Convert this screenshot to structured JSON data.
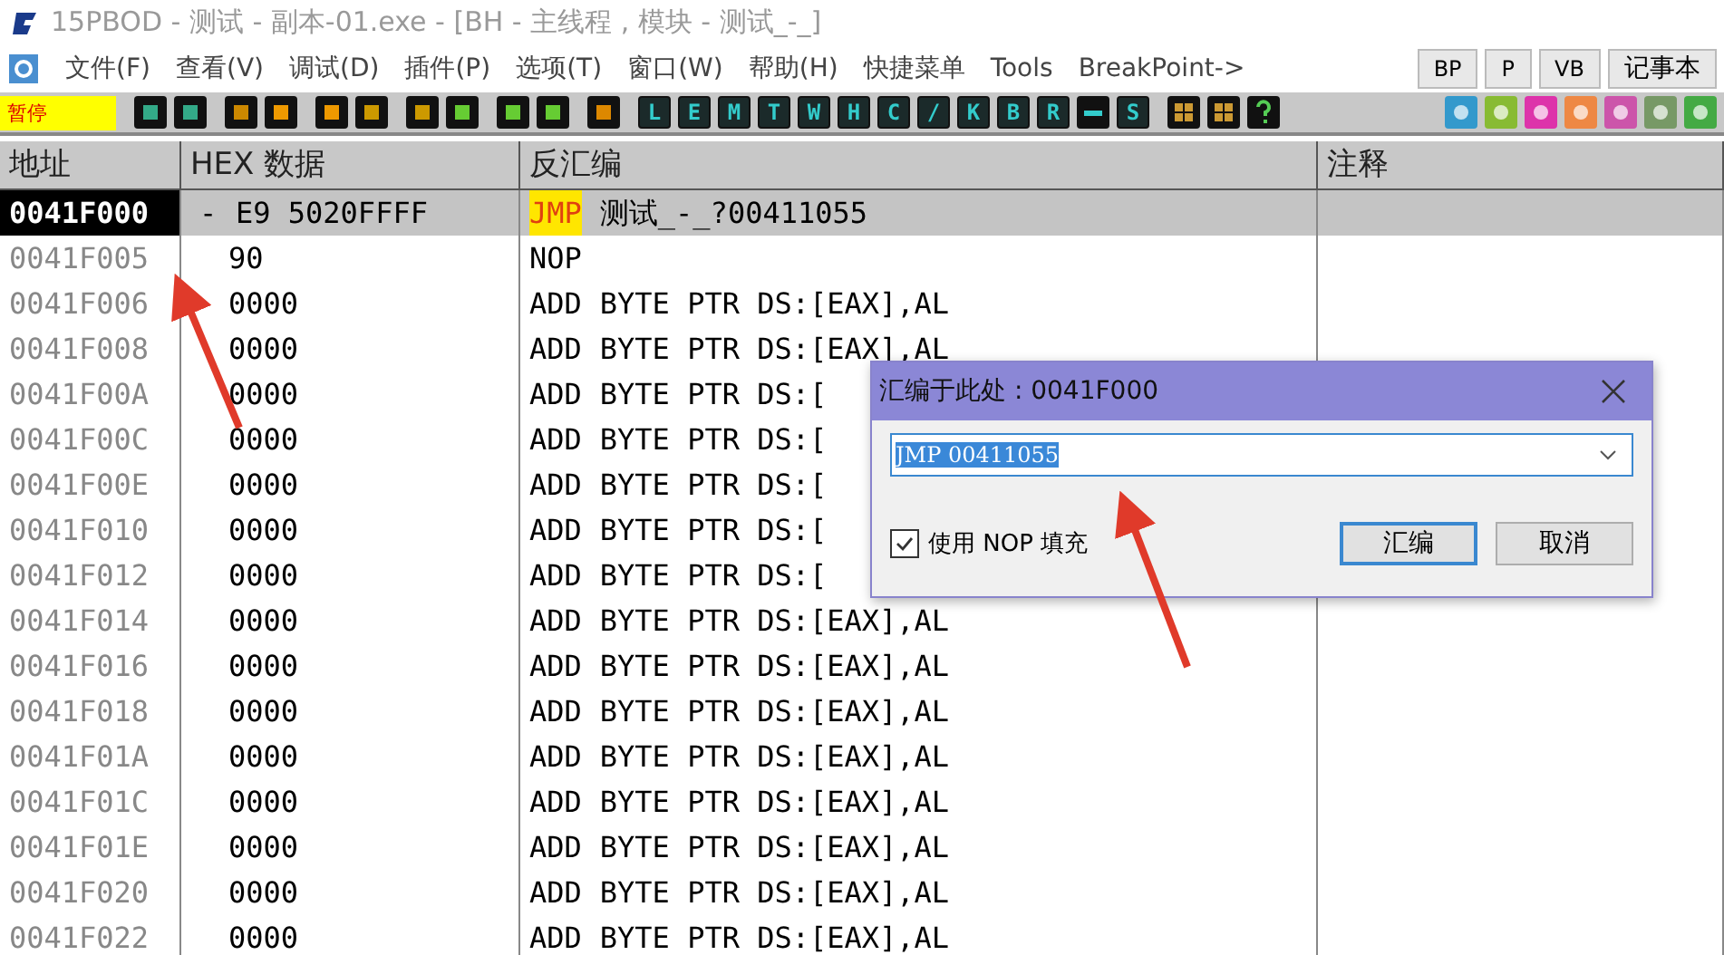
{
  "window": {
    "title": "15PBOD  - 测试 - 副本-01.exe - [BH - 主线程 , 模块 - 测试_-_]"
  },
  "menu": [
    "文件(F)",
    "查看(V)",
    "调试(D)",
    "插件(P)",
    "选项(T)",
    "窗口(W)",
    "帮助(H)",
    "快捷菜单",
    "Tools",
    "BreakPoint->"
  ],
  "menu_buttons": [
    "BP",
    "P",
    "VB",
    "记事本"
  ],
  "status": "暂停",
  "toolbar_letters": [
    {
      "kind": "letter",
      "label": "L"
    },
    {
      "kind": "letter",
      "label": "E"
    },
    {
      "kind": "letter",
      "label": "M"
    },
    {
      "kind": "letter",
      "label": "T"
    },
    {
      "kind": "letter",
      "label": "W"
    },
    {
      "kind": "letter",
      "label": "H"
    },
    {
      "kind": "letter",
      "label": "C"
    },
    {
      "kind": "letter",
      "label": "/"
    },
    {
      "kind": "letter",
      "label": "K"
    },
    {
      "kind": "letter",
      "label": "B"
    },
    {
      "kind": "letter",
      "label": "R"
    },
    {
      "kind": "dots"
    },
    {
      "kind": "letter",
      "label": "S"
    }
  ],
  "table": {
    "columns": [
      "地址",
      "HEX 数据",
      "反汇编",
      "注释"
    ],
    "rows": [
      {
        "address": "0041F000",
        "jump_mark": "-",
        "hex": "E9 5020FFFF",
        "mnemonic": "JMP",
        "operands": "测试_-_?00411055",
        "highlight": true,
        "selected": true
      },
      {
        "address": "0041F005",
        "hex": "90",
        "mnemonic": "NOP",
        "highlight": false,
        "selected": false
      },
      {
        "address": "0041F006",
        "hex": "0000",
        "mnemonic": "ADD",
        "operands": "BYTE PTR DS:[EAX],AL",
        "highlight": false,
        "selected": false
      },
      {
        "address": "0041F008",
        "hex": "0000",
        "mnemonic": "ADD",
        "operands": "BYTE PTR DS:[EAX],AL",
        "highlight": false,
        "selected": false
      },
      {
        "address": "0041F00A",
        "hex": "0000",
        "mnemonic": "ADD",
        "operands": "BYTE PTR DS:[",
        "highlight": false,
        "selected": false
      },
      {
        "address": "0041F00C",
        "hex": "0000",
        "mnemonic": "ADD",
        "operands": "BYTE PTR DS:[",
        "highlight": false,
        "selected": false
      },
      {
        "address": "0041F00E",
        "hex": "0000",
        "mnemonic": "ADD",
        "operands": "BYTE PTR DS:[",
        "highlight": false,
        "selected": false
      },
      {
        "address": "0041F010",
        "hex": "0000",
        "mnemonic": "ADD",
        "operands": "BYTE PTR DS:[",
        "highlight": false,
        "selected": false
      },
      {
        "address": "0041F012",
        "hex": "0000",
        "mnemonic": "ADD",
        "operands": "BYTE PTR DS:[",
        "highlight": false,
        "selected": false
      },
      {
        "address": "0041F014",
        "hex": "0000",
        "mnemonic": "ADD",
        "operands": "BYTE PTR DS:[EAX],AL",
        "highlight": false,
        "selected": false
      },
      {
        "address": "0041F016",
        "hex": "0000",
        "mnemonic": "ADD",
        "operands": "BYTE PTR DS:[EAX],AL",
        "highlight": false,
        "selected": false
      },
      {
        "address": "0041F018",
        "hex": "0000",
        "mnemonic": "ADD",
        "operands": "BYTE PTR DS:[EAX],AL",
        "highlight": false,
        "selected": false
      },
      {
        "address": "0041F01A",
        "hex": "0000",
        "mnemonic": "ADD",
        "operands": "BYTE PTR DS:[EAX],AL",
        "highlight": false,
        "selected": false
      },
      {
        "address": "0041F01C",
        "hex": "0000",
        "mnemonic": "ADD",
        "operands": "BYTE PTR DS:[EAX],AL",
        "highlight": false,
        "selected": false
      },
      {
        "address": "0041F01E",
        "hex": "0000",
        "mnemonic": "ADD",
        "operands": "BYTE PTR DS:[EAX],AL",
        "highlight": false,
        "selected": false
      },
      {
        "address": "0041F020",
        "hex": "0000",
        "mnemonic": "ADD",
        "operands": "BYTE PTR DS:[EAX],AL",
        "highlight": false,
        "selected": false
      },
      {
        "address": "0041F022",
        "hex": "0000",
        "mnemonic": "ADD",
        "operands": "BYTE PTR DS:[EAX],AL",
        "highlight": false,
        "selected": false
      }
    ]
  },
  "dialog": {
    "title": "汇编于此处 : 0041F000",
    "value": "JMP 00411055",
    "checkbox": {
      "label": "使用 NOP 填充",
      "checked": true
    },
    "buttons": [
      "汇编",
      "取消"
    ]
  }
}
